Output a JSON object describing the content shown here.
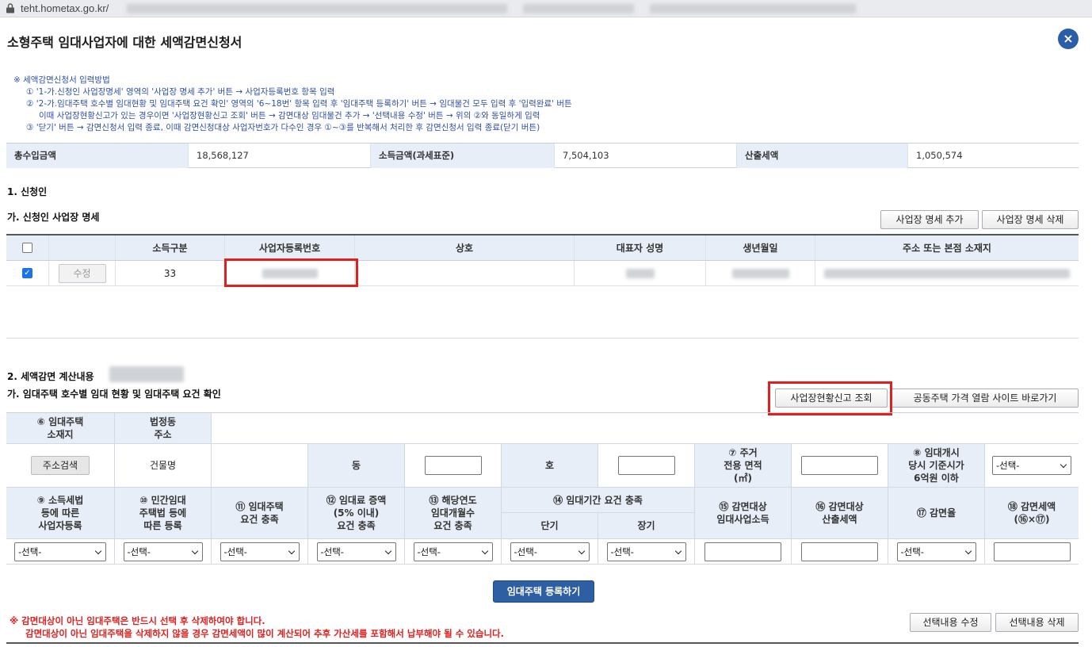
{
  "browser": {
    "url": "teht.hometax.go.kr/"
  },
  "header": {
    "title": "소형주택 임대사업자에 대한 세액감면신청서",
    "close_icon": "×"
  },
  "instructions": {
    "heading": "※ 세액감면신청서 입력방법",
    "steps": [
      "① '1-가.신청인 사업장명세' 영역의 '사업장 명세 추가' 버튼 → 사업자등록번호 항목 입력",
      "② '2-가.임대주택 호수별 임대현황 및 임대주택 요건 확인' 영역의 '6~18번' 항목 입력 후 '임대주택 등록하기' 버튼 → 임대물건 모두 입력 후 '입력완료' 버튼",
      "이때 사업장현황신고가 있는 경우이면 '사업장현황신고 조회' 버튼 → 감면대상 임대물건 추가 → '선택내용 수정' 버튼 → 위의 ②와 동일하게 입력",
      "③ '닫기' 버튼 → 감면신청서 입력 종료, 이때 감면신청대상 사업자번호가 다수인 경우 ①~③를 반복해서 처리한 후 감면신청서 입력 종료(닫기 버튼)"
    ]
  },
  "summary": [
    {
      "label": "총수입금액",
      "value": "18,568,127"
    },
    {
      "label": "소득금액(과세표준)",
      "value": "7,504,103"
    },
    {
      "label": "산출세액",
      "value": "1,050,574"
    }
  ],
  "section1": {
    "title": "1. 신청인",
    "subtitle": "가. 신청인 사업장 명세",
    "add_button": "사업장 명세 추가",
    "delete_button": "사업장 명세 삭제",
    "columns": [
      "소득구분",
      "사업자등록번호",
      "상호",
      "대표자 성명",
      "생년월일",
      "주소 또는 본점 소재지"
    ],
    "row": {
      "checked": true,
      "edit_label": "수정",
      "income_type": "33"
    }
  },
  "section2": {
    "title": "2. 세액감면 계산내용",
    "subtitle": "가. 임대주택 호수별 임대 현황 및 임대주택 요건 확인",
    "lookup_button": "사업장현황신고 조회",
    "site_button": "공동주택 가격 열람 사이트 바로가기",
    "h_location": "⑥ 임대주택\n소재지",
    "h_legal_addr": "법정동\n주소",
    "addr_search": "주소검색",
    "h_building": "건물명",
    "h_dong": "동",
    "h_ho": "호",
    "h_area": "⑦ 주거\n전용 면적\n(㎡)",
    "h_price": "⑧ 임대개시\n당시 기준시가\n6억원 이하",
    "h9": "⑨ 소득세법\n등에 따른\n사업자등록",
    "h10": "⑩ 민간임대\n주택법 등에\n따른 등록",
    "h11": "⑪ 임대주택\n요건 충족",
    "h12": "⑫ 임대료 증액\n(5% 이내)\n요건 충족",
    "h13": "⑬ 해당연도\n임대개월수\n요건 충족",
    "h14": "⑭ 임대기간 요건 충족",
    "h14_short": "단기",
    "h14_long": "장기",
    "h15": "⑮ 감면대상\n임대사업소득",
    "h16": "⑯ 감면대상\n산출세액",
    "h17": "⑰ 감면율",
    "h18": "⑱ 감면세액\n(⑯×⑰)",
    "select_placeholder": "-선택-",
    "register_button": "임대주택 등록하기"
  },
  "warning": {
    "line1": "※ 감면대상이 아닌 임대주택은 반드시 선택 후 삭제하여야 합니다.",
    "line2": "감면대상이 아닌 임대주택을 삭제하지 않을 경우 감면세액이 많이 계산되어 추후 가산세를 포함해서 납부해야 될 수 있습니다."
  },
  "bottom_buttons": {
    "modify": "선택내용 수정",
    "delete": "선택내용 삭제"
  }
}
